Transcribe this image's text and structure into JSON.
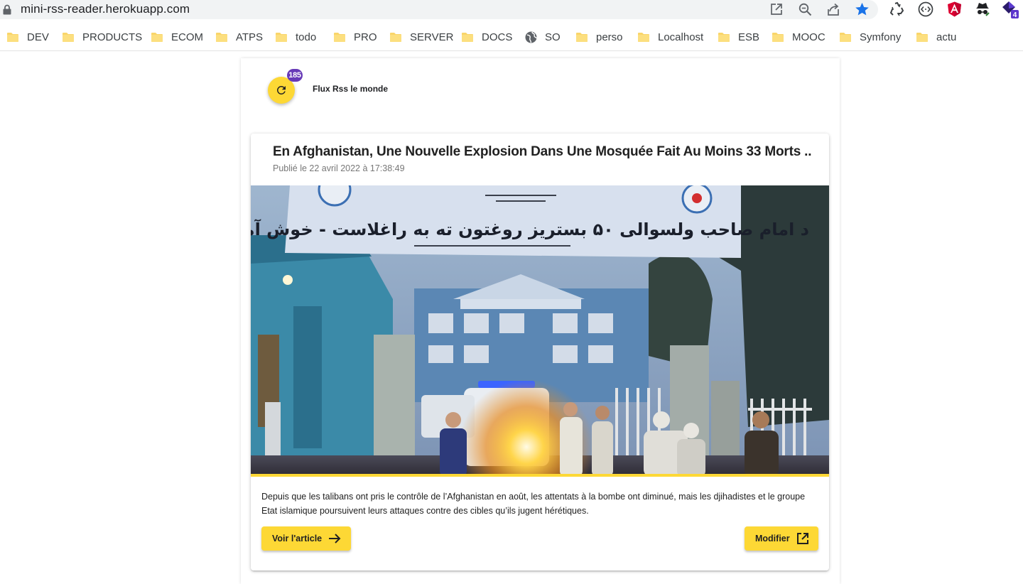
{
  "browser": {
    "url": "mini-rss-reader.herokuapp.com",
    "omnibox_icons": [
      "open-in-app-icon",
      "zoom-icon",
      "share-icon",
      "bookmark-star-icon"
    ],
    "extensions": [
      "recycle-extension-icon",
      "code-extension-icon",
      "angular-extension-icon",
      "incognito-extension-icon",
      "purple-extension-icon"
    ],
    "extension_badge": "4",
    "accent": "#1a73e8"
  },
  "bookmarks": [
    {
      "label": "DEV",
      "icon": "folder-icon"
    },
    {
      "label": "PRODUCTS",
      "icon": "folder-icon"
    },
    {
      "label": "ECOM",
      "icon": "folder-icon"
    },
    {
      "label": "ATPS",
      "icon": "folder-icon"
    },
    {
      "label": "todo",
      "icon": "folder-icon"
    },
    {
      "label": "PRO",
      "icon": "folder-icon"
    },
    {
      "label": "SERVER",
      "icon": "folder-icon"
    },
    {
      "label": "DOCS",
      "icon": "folder-icon"
    },
    {
      "label": "SO",
      "icon": "globe-icon"
    },
    {
      "label": "perso",
      "icon": "folder-icon"
    },
    {
      "label": "Localhost",
      "icon": "folder-icon"
    },
    {
      "label": "ESB",
      "icon": "folder-icon"
    },
    {
      "label": "MOOC",
      "icon": "folder-icon"
    },
    {
      "label": "Symfony",
      "icon": "folder-icon"
    },
    {
      "label": "actu",
      "icon": "folder-icon"
    }
  ],
  "feed": {
    "refresh_icon": "refresh-icon",
    "count": "185",
    "title": "Flux Rss le monde",
    "accent": "#fdd835",
    "badge_color": "#673ab7"
  },
  "article": {
    "title": "En Afghanistan, Une Nouvelle Explosion Dans Une Mosquée Fait Au Moins 33 Morts ..",
    "date": "Publié le 22 avril 2022 à 17:38:49",
    "image_sign_text": "د امام صاحب ولسوالی ۵۰ بستریز روغتون ته به راغلاست - خوش آمدید",
    "description": "Depuis que les talibans ont pris le contrôle de l’Afghanistan en août, les attentats à la bombe ont diminué, mais les djihadistes et le groupe Etat islamique poursuivent leurs attaques contre des cibles qu’ils jugent hérétiques.",
    "read_button": "Voir l'article",
    "read_icon": "arrow-right-icon",
    "edit_button": "Modifier",
    "edit_icon": "open-in-new-icon"
  }
}
